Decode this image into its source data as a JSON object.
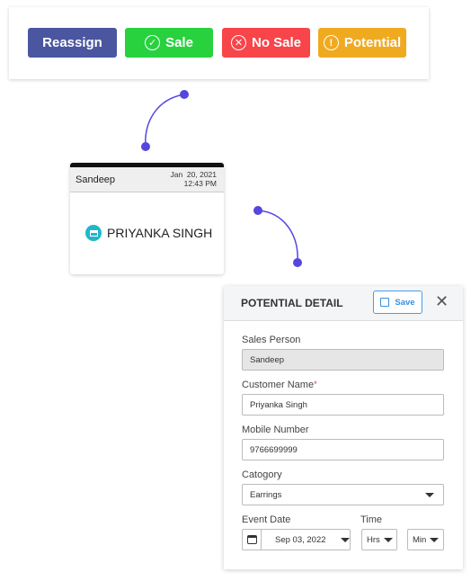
{
  "actions": {
    "reassign": "Reassign",
    "sale": "Sale",
    "no_sale": "No Sale",
    "potential": "Potential",
    "colors": {
      "reassign": "#4a56a0",
      "sale": "#28d23f",
      "no_sale": "#f7454a",
      "potential": "#f0aa20",
      "connector": "#5546e0"
    }
  },
  "card": {
    "sales_person": "Sandeep",
    "date": "Jan  20, 2021",
    "time": "12:43 PM",
    "customer": "PRIYANKA SINGH"
  },
  "panel": {
    "title": "POTENTIAL DETAIL",
    "save_label": "Save",
    "sales_person_label": "Sales Person",
    "sales_person_value": "Sandeep",
    "customer_name_label": "Customer Name",
    "required_mark": "*",
    "customer_name_value": "Priyanka Singh",
    "mobile_label": "Mobile Number",
    "mobile_value": "9766699999",
    "category_label": "Catogory",
    "category_value": "Earrings",
    "event_date_label": "Event Date",
    "event_date_value": "Sep 03, 2022",
    "time_label": "Time",
    "hours_value": "Hrs",
    "minutes_value": "Min"
  }
}
